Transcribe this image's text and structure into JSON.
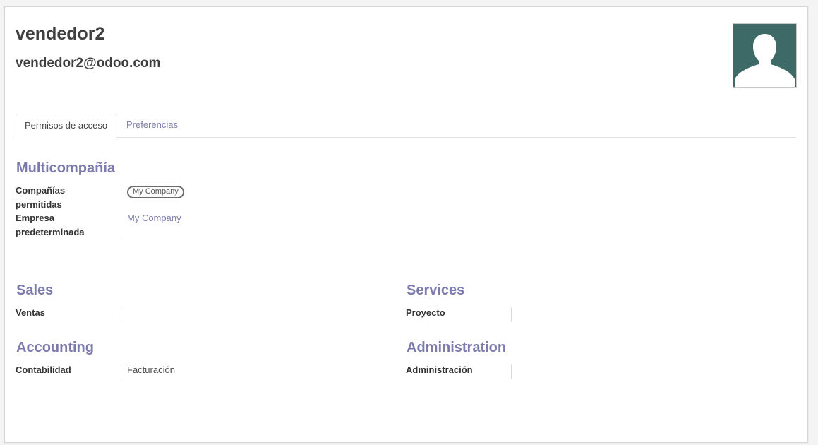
{
  "user": {
    "name": "vendedor2",
    "email": "vendedor2@odoo.com"
  },
  "avatar": {
    "icon": "person-silhouette-icon",
    "bg_color": "#3d6a67"
  },
  "tabs": [
    {
      "label": "Permisos de acceso",
      "active": true
    },
    {
      "label": "Preferencias",
      "active": false
    }
  ],
  "multicompany": {
    "title": "Multicompañía",
    "allowed_companies_label_1": "Compañías",
    "allowed_companies_label_2": "permitidas",
    "allowed_companies_tag": "My Company",
    "default_company_label_1": "Empresa",
    "default_company_label_2": "predeterminada",
    "default_company_value": "My Company"
  },
  "sales": {
    "title": "Sales",
    "field_label": "Ventas",
    "field_value": ""
  },
  "services": {
    "title": "Services",
    "field_label": "Proyecto",
    "field_value": ""
  },
  "accounting": {
    "title": "Accounting",
    "field_label": "Contabilidad",
    "field_value": "Facturación"
  },
  "administration": {
    "title": "Administration",
    "field_label": "Administración",
    "field_value": ""
  },
  "colors": {
    "accent": "#7c7bad",
    "text": "#4c4c4c"
  }
}
